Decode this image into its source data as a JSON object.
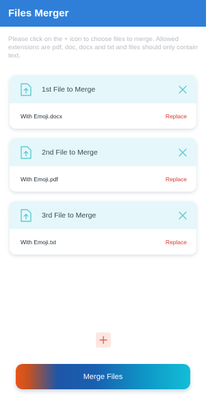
{
  "app": {
    "title": "Files Merger"
  },
  "instructions": "Please click on the + icon to choose files to merge. Allowed extensions are pdf, doc, docx and txt and files should only contain text.",
  "cards": [
    {
      "title": "1st File to Merge",
      "file_name": "With Emoji.docx",
      "replace_label": "Replace"
    },
    {
      "title": "2nd File to Merge",
      "file_name": "With Emoji.pdf",
      "replace_label": "Replace"
    },
    {
      "title": "3rd File to Merge",
      "file_name": "With Emoji.txt",
      "replace_label": "Replace"
    }
  ],
  "icons": {
    "file": "file-upload-icon",
    "close": "close-icon",
    "add": "plus-icon"
  },
  "colors": {
    "appbar": "#2f7fd8",
    "card_header": "#e5f7fa",
    "icon_accent": "#5ecbd3",
    "replace": "#d83a2a",
    "add_button_bg": "#fde6e1"
  },
  "merge_button": {
    "label": "Merge Files"
  }
}
